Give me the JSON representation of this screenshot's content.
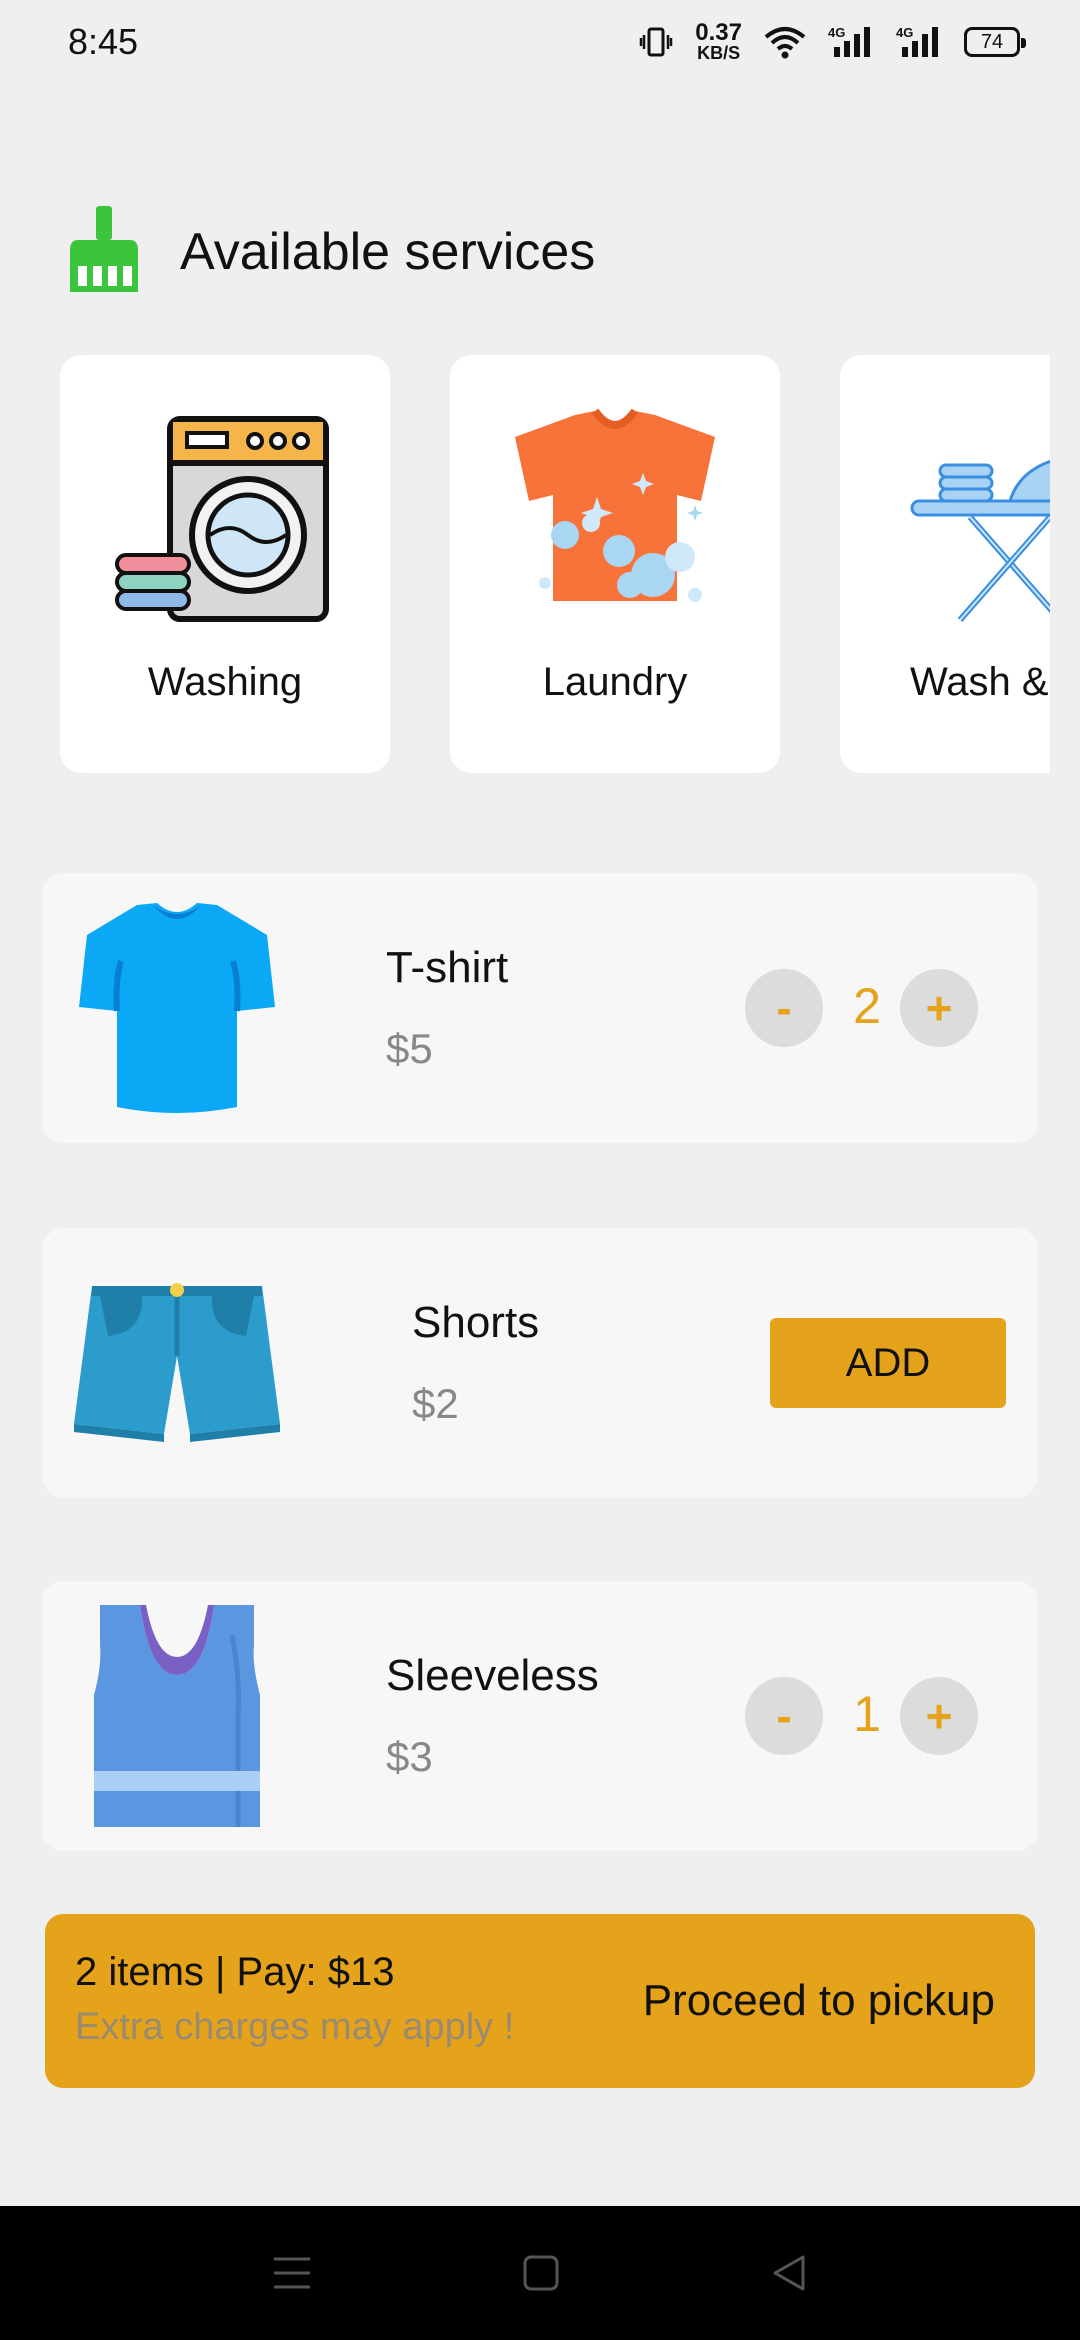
{
  "status_bar": {
    "time": "8:45",
    "net_speed_value": "0.37",
    "net_speed_unit": "KB/S",
    "battery": "74",
    "signal_label_1": "4G",
    "signal_label_2": "4G"
  },
  "header": {
    "title": "Available services",
    "icon": "broom-icon",
    "icon_color": "#3cc43c"
  },
  "services": [
    {
      "label": "Washing",
      "icon": "washing-machine-icon"
    },
    {
      "label": "Laundry",
      "icon": "clean-shirt-icon"
    },
    {
      "label": "Wash &",
      "icon": "ironing-board-icon"
    }
  ],
  "items": [
    {
      "name": "T-shirt",
      "price": "$5",
      "quantity": "2",
      "minus": "-",
      "plus": "+",
      "icon": "tshirt-icon"
    },
    {
      "name": "Shorts",
      "price": "$2",
      "action": "ADD",
      "icon": "shorts-icon"
    },
    {
      "name": "Sleeveless",
      "price": "$3",
      "quantity": "1",
      "minus": "-",
      "plus": "+",
      "icon": "tank-top-icon"
    }
  ],
  "checkout": {
    "summary": "2 items | Pay: $13",
    "note": "Extra charges may apply !",
    "cta": "Proceed to pickup"
  },
  "colors": {
    "accent": "#e5a31c",
    "card": "#f7f7f7",
    "background": "#efefef"
  },
  "nav_bar": {
    "icons": [
      "menu-icon",
      "home-icon",
      "back-icon"
    ]
  }
}
